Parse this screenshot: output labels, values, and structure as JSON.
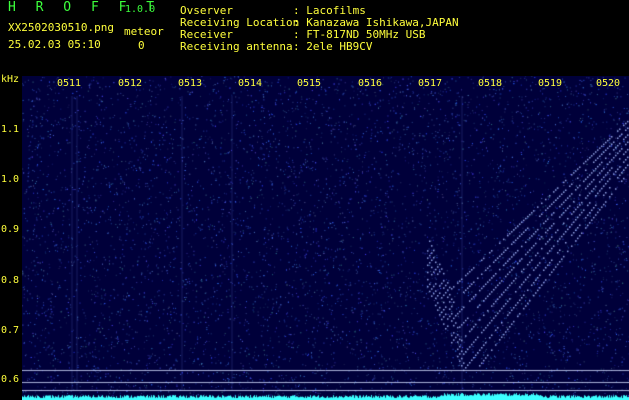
{
  "app": {
    "name": "H R O F F T",
    "version": "1.0.0"
  },
  "file": {
    "name": "XX2502030510.png",
    "datetime": "25.02.03 05:10"
  },
  "meteor": {
    "label": "meteor",
    "count": "0"
  },
  "info": {
    "observer_label": "Ovserver",
    "observer_value": ": Lacofilms",
    "location_label": "Receiving Location",
    "location_value": ": Kanazawa Ishikawa,JAPAN",
    "receiver_label": "Receiver",
    "receiver_value": ": FT-817ND 50MHz USB",
    "antenna_label": "Receiving antenna",
    "antenna_value": ": 2ele HB9CV"
  },
  "axis": {
    "unit": "kHz",
    "y_ticks": [
      "1.1",
      "1.0",
      "0.9",
      "0.8",
      "0.7",
      "0.6"
    ],
    "x_ticks": [
      "0511",
      "0512",
      "0513",
      "0514",
      "0515",
      "0516",
      "0517",
      "0518",
      "0519",
      "0520"
    ]
  },
  "colors": {
    "green": "#3cff3c",
    "yellow": "#ffff3c",
    "cyan": "#3cffff",
    "background": "#00003a"
  }
}
